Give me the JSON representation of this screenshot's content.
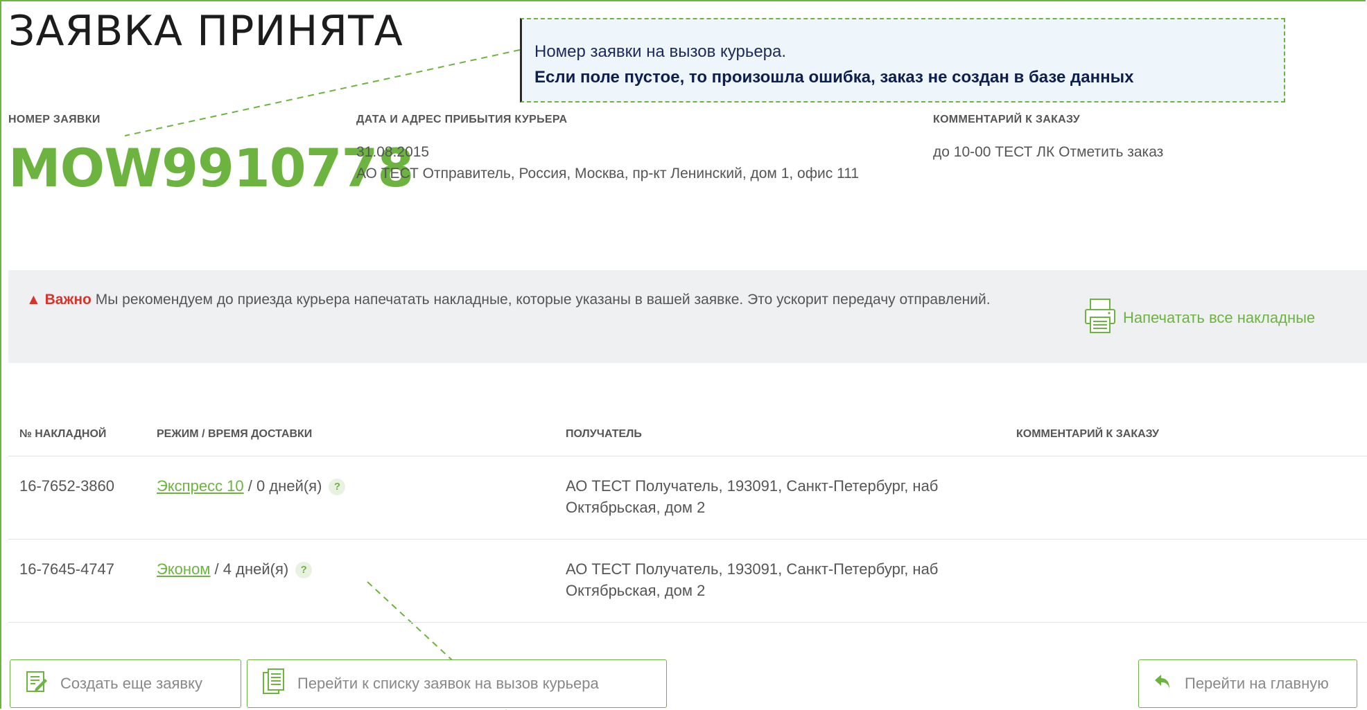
{
  "page": {
    "title": "ЗАЯВКА ПРИНЯТА"
  },
  "callout": {
    "line1": "Номер заявки на вызов курьера.",
    "line2": "Если поле пустое, то произошла ошибка, заказ не создан в базе данных"
  },
  "order": {
    "number_label": "НОМЕР ЗАЯВКИ",
    "number": "MOW9910778",
    "date_label": "ДАТА И АДРЕС ПРИБЫТИЯ КУРЬЕРА",
    "date": "31.08.2015",
    "address": "АО ТЕСТ Отправитель, Россия, Москва, пр-кт Ленинский, дом 1, офис 111",
    "comment_label": "КОММЕНТАРИЙ К ЗАКАЗУ",
    "comment": "до 10-00 ТЕСТ ЛК Отметить заказ"
  },
  "notice": {
    "important": "Важно",
    "text": "Мы рекомендуем до приезда курьера напечатать накладные, которые указаны в вашей заявке. Это ускорит передачу отправлений.",
    "print_label": "Напечатать все накладные"
  },
  "table": {
    "headers": {
      "waybill": "№ НАКЛАДНОЙ",
      "mode": "РЕЖИМ / ВРЕМЯ ДОСТАВКИ",
      "recipient": "ПОЛУЧАТЕЛЬ",
      "comment": "КОММЕНТАРИЙ К ЗАКАЗУ"
    },
    "rows": [
      {
        "waybill": "16-7652-3860",
        "mode": "Экспресс 10",
        "time": " / 0 дней(я)",
        "help": "?",
        "recipient": "АО ТЕСТ Получатель, 193091, Санкт-Петербург, наб Октябрьская, дом 2"
      },
      {
        "waybill": "16-7645-4747",
        "mode": "Эконом",
        "time": " / 4 дней(я)",
        "help": "?",
        "recipient": "АО ТЕСТ Получатель, 193091, Санкт-Петербург, наб Октябрьская, дом 2"
      }
    ]
  },
  "buttons": {
    "create": "Создать еще заявку",
    "list": "Перейти к списку заявок на вызов курьера",
    "home": "Перейти на главную"
  },
  "colors": {
    "accent": "#6cb33f",
    "warn": "#d9332b",
    "notice_bg": "#eef0f1"
  },
  "icons": {
    "print": "printer-icon",
    "create": "edit-document-icon",
    "list": "documents-list-icon",
    "home": "back-arrow-icon",
    "warn": "warning-triangle-icon"
  }
}
